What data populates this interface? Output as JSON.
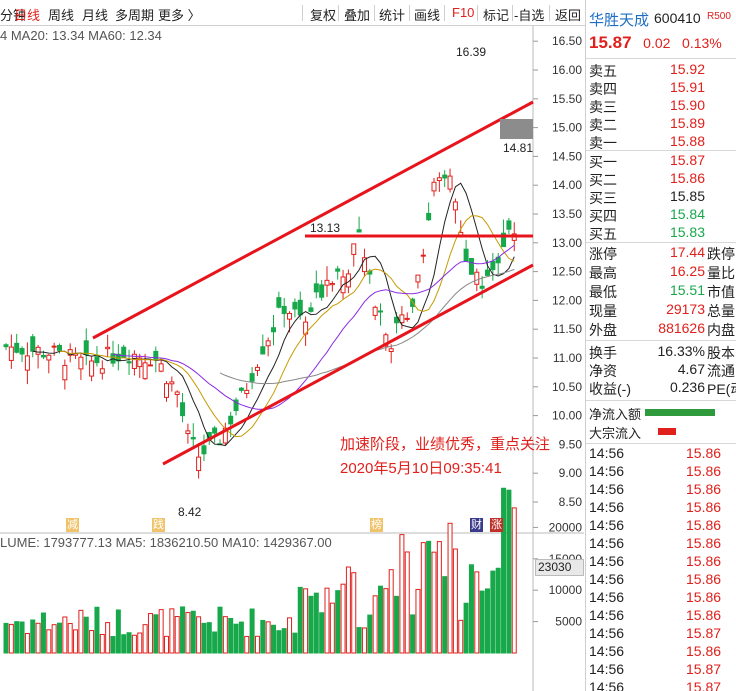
{
  "toolbar": {
    "items": [
      "分钟",
      "日线",
      "周线",
      "月线",
      "多周期",
      "更多 〉"
    ],
    "right_items": [
      "复权",
      "叠加",
      "统计",
      "画线",
      "F10",
      "标记",
      "-自选",
      "返回"
    ]
  },
  "indicators": {
    "ma_line": "4  MA20: 13.34  MA60: 12.34",
    "volume_line": "LUME: 1793777.13  MA5: 1836210.50  MA10: 1429367.00"
  },
  "annotations": {
    "text1": "加速阶段，业绩优秀，重点关注",
    "text2": "2020年5月10日09:35:41",
    "label_high": "16.39",
    "label_1481": "14.81",
    "label_1313": "13.13",
    "label_low": "8.42",
    "vol_box": "23030",
    "markers": [
      "减",
      "践",
      "榜",
      "财",
      "涨"
    ]
  },
  "stock": {
    "name": "华胜天成",
    "code": "600410",
    "badge": "R500",
    "price": "15.87",
    "change": "0.02",
    "change_pct": "0.13%"
  },
  "order_book": {
    "asks": [
      {
        "label": "卖五",
        "price": "15.92"
      },
      {
        "label": "卖四",
        "price": "15.91"
      },
      {
        "label": "卖三",
        "price": "15.90"
      },
      {
        "label": "卖二",
        "price": "15.89"
      },
      {
        "label": "卖一",
        "price": "15.88"
      }
    ],
    "bids": [
      {
        "label": "买一",
        "price": "15.87",
        "color": "red"
      },
      {
        "label": "买二",
        "price": "15.86",
        "color": "red"
      },
      {
        "label": "买三",
        "price": "15.85",
        "color": "black"
      },
      {
        "label": "买四",
        "price": "15.84",
        "color": "green"
      },
      {
        "label": "买五",
        "price": "15.83",
        "color": "green"
      }
    ]
  },
  "stats": [
    {
      "label": "涨停",
      "value": "17.44",
      "tail": "跌停",
      "color": "red"
    },
    {
      "label": "最高",
      "value": "16.25",
      "tail": "量比",
      "color": "red"
    },
    {
      "label": "最低",
      "value": "15.51",
      "tail": "市值",
      "color": "green"
    },
    {
      "label": "现量",
      "value": "29173",
      "tail": "总量",
      "color": "red"
    },
    {
      "label": "外盘",
      "value": "881626",
      "tail": "内盘",
      "color": "red"
    }
  ],
  "stats2": [
    {
      "label": "换手",
      "value": "16.33%",
      "tail": "股本"
    },
    {
      "label": "净资",
      "value": "4.67",
      "tail": "流通"
    },
    {
      "label": "收益(-)",
      "value": "0.236",
      "tail": "PE(动"
    }
  ],
  "flows": [
    {
      "label": "净流入额"
    },
    {
      "label": "大宗流入"
    }
  ],
  "ticks": [
    {
      "time": "14:56",
      "price": "15.86"
    },
    {
      "time": "14:56",
      "price": "15.86"
    },
    {
      "time": "14:56",
      "price": "15.86"
    },
    {
      "time": "14:56",
      "price": "15.86"
    },
    {
      "time": "14:56",
      "price": "15.86"
    },
    {
      "time": "14:56",
      "price": "15.86"
    },
    {
      "time": "14:56",
      "price": "15.86"
    },
    {
      "time": "14:56",
      "price": "15.86"
    },
    {
      "time": "14:56",
      "price": "15.86"
    },
    {
      "time": "14:56",
      "price": "15.86"
    },
    {
      "time": "14:56",
      "price": "15.87"
    },
    {
      "time": "14:56",
      "price": "15.86"
    },
    {
      "time": "14:56",
      "price": "15.87"
    },
    {
      "time": "14:56",
      "price": "15.87"
    }
  ],
  "price_axis": [
    "16.50",
    "16.00",
    "15.50",
    "15.00",
    "14.50",
    "14.00",
    "13.50",
    "13.00",
    "12.50",
    "12.00",
    "11.50",
    "11.00",
    "10.50",
    "10.00",
    "9.50",
    "9.00",
    "8.50"
  ],
  "volume_axis": [
    "20000",
    "15000",
    "10000",
    "5000"
  ],
  "colors": {
    "up": "#e0201c",
    "down": "#17a84a",
    "accent": "#1e6fc4",
    "trendline": "#e8141c"
  }
}
